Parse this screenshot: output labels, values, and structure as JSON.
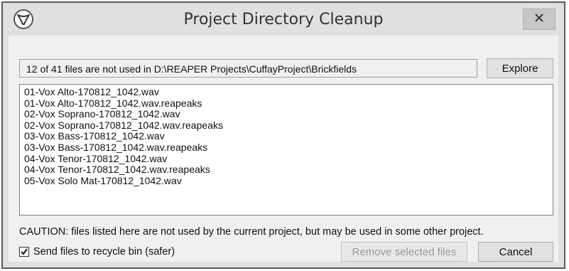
{
  "window": {
    "title": "Project Directory Cleanup",
    "app_icon": "reaper-icon",
    "close_icon": "close-icon"
  },
  "info": {
    "text": "12 of 41 files are not used in D:\\REAPER Projects\\CuffayProject\\Brickfields"
  },
  "buttons": {
    "explore": "Explore",
    "remove": "Remove selected files",
    "cancel": "Cancel"
  },
  "files": [
    "01-Vox Alto-170812_1042.wav",
    "01-Vox Alto-170812_1042.wav.reapeaks",
    "02-Vox Soprano-170812_1042.wav",
    "02-Vox Soprano-170812_1042.wav.reapeaks",
    "03-Vox Bass-170812_1042.wav",
    "03-Vox Bass-170812_1042.wav.reapeaks",
    "04-Vox Tenor-170812_1042.wav",
    "04-Vox Tenor-170812_1042.wav.reapeaks",
    "05-Vox Solo Mat-170812_1042.wav"
  ],
  "caution": "CAUTION: files listed here are not used by the current project, but may be used in some other project.",
  "recycle": {
    "label": "Send files to recycle bin (safer)",
    "checked": true
  }
}
